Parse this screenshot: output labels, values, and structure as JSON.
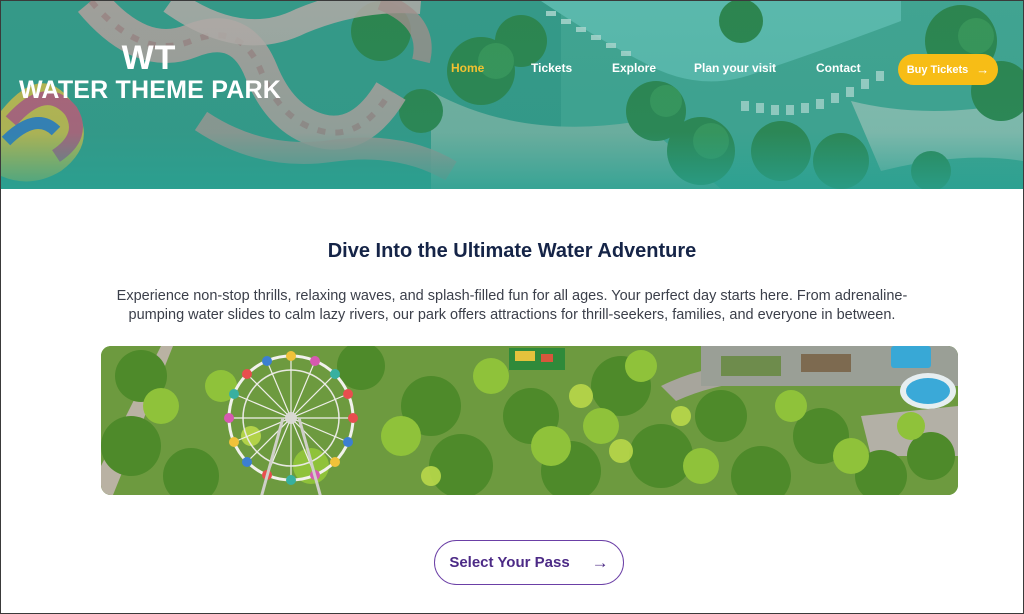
{
  "logo": {
    "mark": "WT",
    "name": "WATER THEME PARK"
  },
  "nav": {
    "items": [
      {
        "label": "Home",
        "active": true
      },
      {
        "label": "Tickets",
        "active": false
      },
      {
        "label": "Explore",
        "active": false
      },
      {
        "label": "Plan your visit",
        "active": false
      },
      {
        "label": "Contact",
        "active": false
      }
    ],
    "cta": {
      "label": "Buy Tickets",
      "icon": "arrow-right-icon"
    }
  },
  "main": {
    "headline": "Dive Into the Ultimate Water Adventure",
    "intro": "Experience non-stop thrills, relaxing waves, and splash-filled fun for all ages. Your perfect day starts here. From adrenaline-pumping water slides to calm lazy rivers, our park offers attractions for thrill-seekers, families, and everyone in between.",
    "photo_icon": "aerial-park-image",
    "pass_button": {
      "label": "Select Your Pass",
      "icon": "arrow-right-icon"
    }
  },
  "colors": {
    "header_teal": "#2e9e8c",
    "active_nav": "#f2c230",
    "cta_yellow": "#f7bd16",
    "headline_navy": "#152447",
    "pass_purple": "#4c2a86"
  }
}
